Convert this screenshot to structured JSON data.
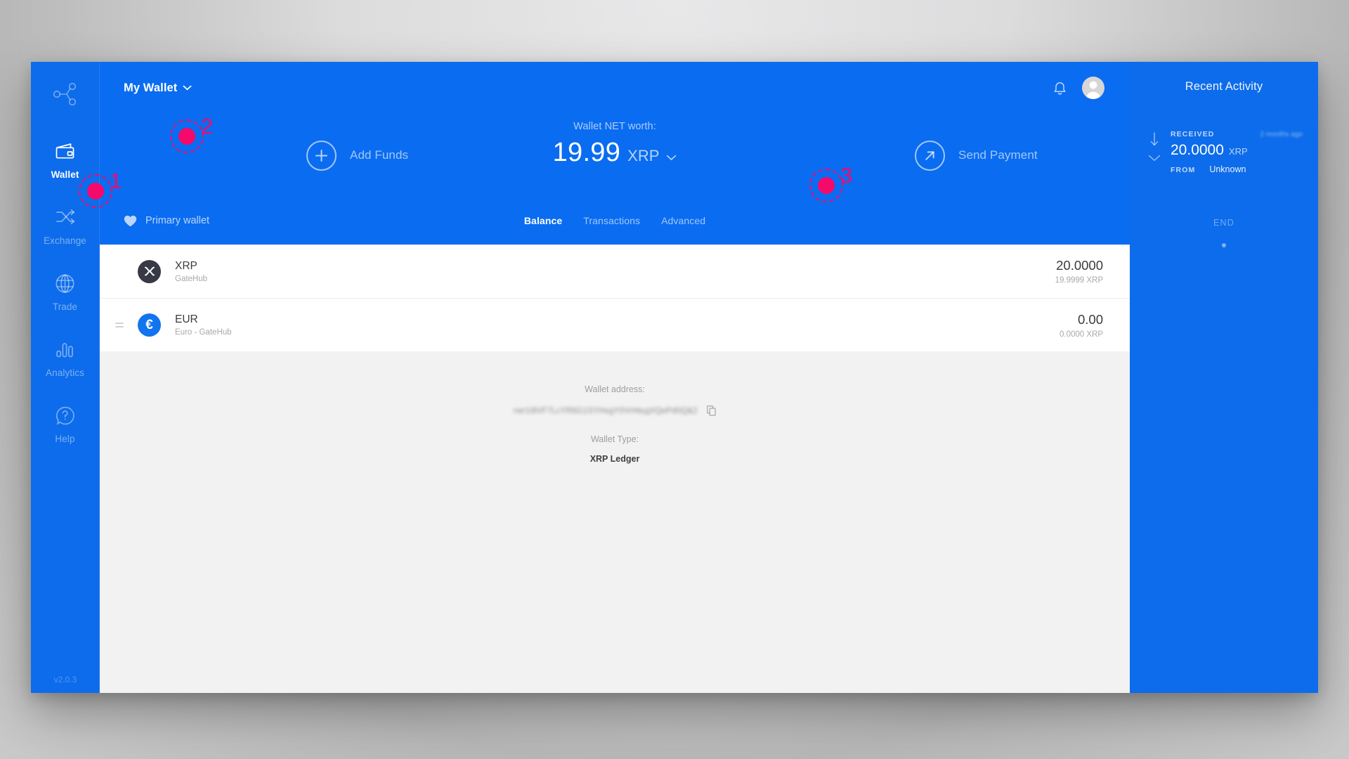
{
  "app": {
    "version": "v2.0.3",
    "logo_icon": "network-nodes-icon"
  },
  "sidebar": {
    "items": [
      {
        "label": "Wallet",
        "icon": "wallet-icon",
        "active": true
      },
      {
        "label": "Exchange",
        "icon": "exchange-icon",
        "active": false
      },
      {
        "label": "Trade",
        "icon": "globe-icon",
        "active": false
      },
      {
        "label": "Analytics",
        "icon": "bar-chart-icon",
        "active": false
      },
      {
        "label": "Help",
        "icon": "question-bubble-icon",
        "active": false
      }
    ]
  },
  "topbar": {
    "wallet_selector_label": "My Wallet",
    "wallet_selector_icon": "chevron-down-icon",
    "notifications_icon": "bell-icon",
    "avatar_icon": "user-avatar-icon"
  },
  "hero": {
    "add_funds_label": "Add Funds",
    "add_funds_icon": "plus-circle-icon",
    "send_payment_label": "Send Payment",
    "send_payment_icon": "arrow-up-right-circle-icon",
    "net_worth_label": "Wallet NET worth:",
    "net_worth_amount": "19.99",
    "net_worth_currency": "XRP",
    "net_worth_chevron_icon": "chevron-down-icon"
  },
  "walletbar": {
    "primary_wallet_label": "Primary wallet",
    "primary_wallet_icon": "heart-icon",
    "tabs": [
      {
        "label": "Balance",
        "active": true
      },
      {
        "label": "Transactions",
        "active": false
      },
      {
        "label": "Advanced",
        "active": false
      }
    ]
  },
  "balances": [
    {
      "code": "XRP",
      "issuer": "GateHub",
      "amount": "20.0000",
      "sub": "19.9999 XRP",
      "icon": "xrp-coin-icon",
      "icon_glyph": "",
      "draggable": false
    },
    {
      "code": "EUR",
      "issuer": "Euro - GateHub",
      "amount": "0.00",
      "sub": "0.0000 XRP",
      "icon": "eur-coin-icon",
      "icon_glyph": "€",
      "draggable": true
    }
  ],
  "wallet_details": {
    "address_label": "Wallet address:",
    "address_value": "rwr1i8VF7LcYR6G1SYHxgY0VrHteдXQePd0Q&2",
    "copy_icon": "copy-icon",
    "type_label": "Wallet Type:",
    "type_value": "XRP Ledger"
  },
  "activity": {
    "title": "Recent Activity",
    "items": [
      {
        "kind": "RECEIVED",
        "time": "2 months ago",
        "amount": "20.0000",
        "currency": "XRP",
        "from_label": "FROM",
        "from_value": "Unknown",
        "direction_icon": "arrow-down-icon",
        "expand_icon": "chevron-down-icon"
      }
    ],
    "end_label": "END"
  },
  "markers": [
    {
      "number": "1"
    },
    {
      "number": "2"
    },
    {
      "number": "3"
    }
  ],
  "colors": {
    "brand_blue": "#0a6cf1",
    "sidebar_blue": "#0d6ceb",
    "marker_pink": "#f5096b",
    "panel_gray": "#f2f2f2"
  }
}
